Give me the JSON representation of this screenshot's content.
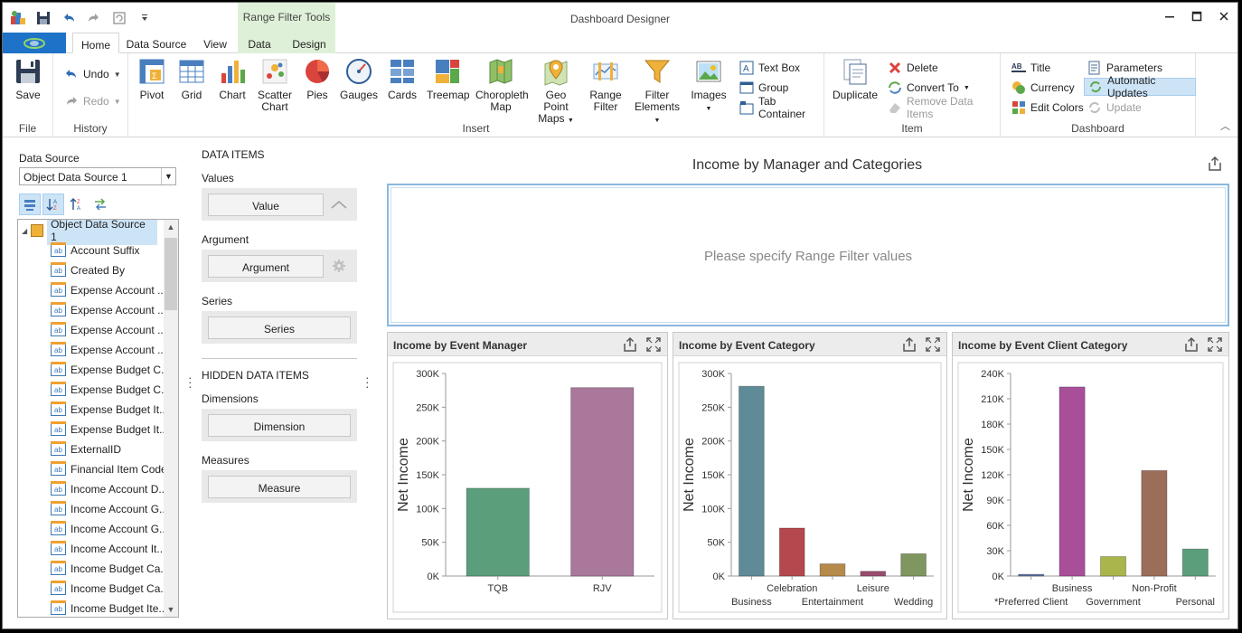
{
  "titlebar": {
    "title": "Dashboard Designer",
    "context_header": "Range Filter Tools"
  },
  "tabs": [
    {
      "label": "Home",
      "active": true
    },
    {
      "label": "Data Source",
      "active": false
    },
    {
      "label": "View",
      "active": false
    },
    {
      "label": "Data",
      "active": false
    },
    {
      "label": "Design",
      "active": false
    }
  ],
  "ribbon": {
    "file": {
      "group": "File",
      "save": "Save"
    },
    "history": {
      "group": "History",
      "undo": "Undo",
      "redo": "Redo"
    },
    "insert": {
      "group": "Insert",
      "pivot": "Pivot",
      "grid": "Grid",
      "chart": "Chart",
      "scatter1": "Scatter",
      "scatter2": "Chart",
      "pies": "Pies",
      "gauges": "Gauges",
      "cards": "Cards",
      "treemap": "Treemap",
      "choro1": "Choropleth",
      "choro2": "Map",
      "geo1": "Geo Point",
      "geo2": "Maps",
      "range1": "Range",
      "range2": "Filter",
      "filter1": "Filter",
      "filter2": "Elements",
      "images": "Images",
      "textbox": "Text Box",
      "group_btn": "Group",
      "tab_container": "Tab Container"
    },
    "item": {
      "group": "Item",
      "duplicate": "Duplicate",
      "delete": "Delete",
      "convert": "Convert To",
      "remove": "Remove Data Items"
    },
    "dashboard": {
      "group": "Dashboard",
      "title": "Title",
      "currency": "Currency",
      "edit_colors": "Edit Colors",
      "parameters": "Parameters",
      "auto_updates": "Automatic Updates",
      "update": "Update"
    }
  },
  "datasource": {
    "label": "Data Source",
    "selected": "Object Data Source 1",
    "root": "Object Data Source 1",
    "fields": [
      "Account Suffix",
      "Created By",
      "Expense Account ...",
      "Expense Account ...",
      "Expense Account ...",
      "Expense Account ...",
      "Expense Budget C...",
      "Expense Budget C...",
      "Expense Budget It...",
      "Expense Budget It...",
      "ExternalID",
      "Financial Item Code",
      "Income Account D...",
      "Income Account G...",
      "Income Account G...",
      "Income Account It...",
      "Income Budget Ca...",
      "Income Budget Ca...",
      "Income Budget Ite..."
    ]
  },
  "dataitems": {
    "header": "DATA ITEMS",
    "values_label": "Values",
    "value_btn": "Value",
    "argument_label": "Argument",
    "argument_btn": "Argument",
    "series_label": "Series",
    "series_btn": "Series",
    "hidden_header": "HIDDEN DATA ITEMS",
    "dimensions_label": "Dimensions",
    "dimension_btn": "Dimension",
    "measures_label": "Measures",
    "measure_btn": "Measure"
  },
  "dashboard": {
    "title": "Income by Manager and Categories",
    "range_message": "Please specify Range Filter values"
  },
  "colors": {
    "accent": "#1e72c7",
    "range_border": "#8bb7e0"
  },
  "chart_data": [
    {
      "type": "bar",
      "title": "Income by Event Manager",
      "ylabel": "Net Income",
      "categories": [
        "TQB",
        "RJV"
      ],
      "values": [
        130000,
        279000
      ],
      "colors": [
        "#5a9e7c",
        "#a9789b"
      ],
      "ylim": [
        0,
        300000
      ],
      "yticks": [
        0,
        50000,
        100000,
        150000,
        200000,
        250000,
        300000
      ],
      "ytick_labels": [
        "0K",
        "50K",
        "100K",
        "150K",
        "200K",
        "250K",
        "300K"
      ],
      "category_rows": [
        0,
        0
      ]
    },
    {
      "type": "bar",
      "title": "Income by Event Category",
      "ylabel": "Net Income",
      "categories": [
        "Business",
        "Celebration",
        "Entertainment",
        "Leisure",
        "Wedding"
      ],
      "values": [
        281000,
        71000,
        18000,
        7000,
        33000
      ],
      "colors": [
        "#5e8b97",
        "#b5474f",
        "#b58a4a",
        "#9a4b6e",
        "#7f9660"
      ],
      "ylim": [
        0,
        300000
      ],
      "yticks": [
        0,
        50000,
        100000,
        150000,
        200000,
        250000,
        300000
      ],
      "ytick_labels": [
        "0K",
        "50K",
        "100K",
        "150K",
        "200K",
        "250K",
        "300K"
      ],
      "category_rows": [
        1,
        0,
        1,
        0,
        1
      ]
    },
    {
      "type": "bar",
      "title": "Income by Event Client Category",
      "ylabel": "Net Income",
      "categories": [
        "*Preferred Client",
        "Business",
        "Government",
        "Non-Profit",
        "Personal"
      ],
      "values": [
        2000,
        224000,
        23000,
        125000,
        32000
      ],
      "colors": [
        "#5b6fa0",
        "#a94f9a",
        "#aab54b",
        "#9b6e5a",
        "#5a9e7c"
      ],
      "ylim": [
        0,
        240000
      ],
      "yticks": [
        0,
        30000,
        60000,
        90000,
        120000,
        150000,
        180000,
        210000,
        240000
      ],
      "ytick_labels": [
        "0K",
        "30K",
        "60K",
        "90K",
        "120K",
        "150K",
        "180K",
        "210K",
        "240K"
      ],
      "category_rows": [
        1,
        0,
        1,
        0,
        1
      ]
    }
  ]
}
